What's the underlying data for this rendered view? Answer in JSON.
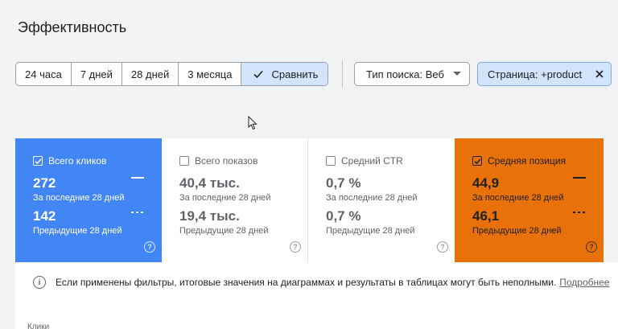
{
  "page": {
    "title": "Эффективность"
  },
  "date_range": {
    "options": [
      "24 часа",
      "7 дней",
      "28 дней",
      "3 месяца"
    ],
    "compare_label": "Сравнить"
  },
  "filters": {
    "search_type": "Тип поиска: Веб",
    "page_filter": "Страница: +product"
  },
  "metrics": [
    {
      "label": "Всего кликов",
      "checked": true,
      "color": "#4285f4",
      "current_value": "272",
      "current_period": "За последние 28 дней",
      "previous_value": "142",
      "previous_period": "Предыдущие 28 дней"
    },
    {
      "label": "Всего показов",
      "checked": false,
      "current_value": "40,4 тыс.",
      "current_period": "За последние 28 дней",
      "previous_value": "19,4 тыс.",
      "previous_period": "Предыдущие 28 дней"
    },
    {
      "label": "Средний CTR",
      "checked": false,
      "current_value": "0,7 %",
      "current_period": "За последние 28 дней",
      "previous_value": "0,7 %",
      "previous_period": "Предыдущие 28 дней"
    },
    {
      "label": "Средняя позиция",
      "checked": true,
      "color": "#e8710a",
      "current_value": "44,9",
      "current_period": "За последние 28 дней",
      "previous_value": "46,1",
      "previous_period": "Предыдущие 28 дней"
    }
  ],
  "notice": {
    "text": "Если применены фильтры, итоговые значения на диаграммах и результаты в таблицах могут быть неполными.",
    "link": "Подробнее"
  },
  "chart": {
    "label": "Клики"
  }
}
